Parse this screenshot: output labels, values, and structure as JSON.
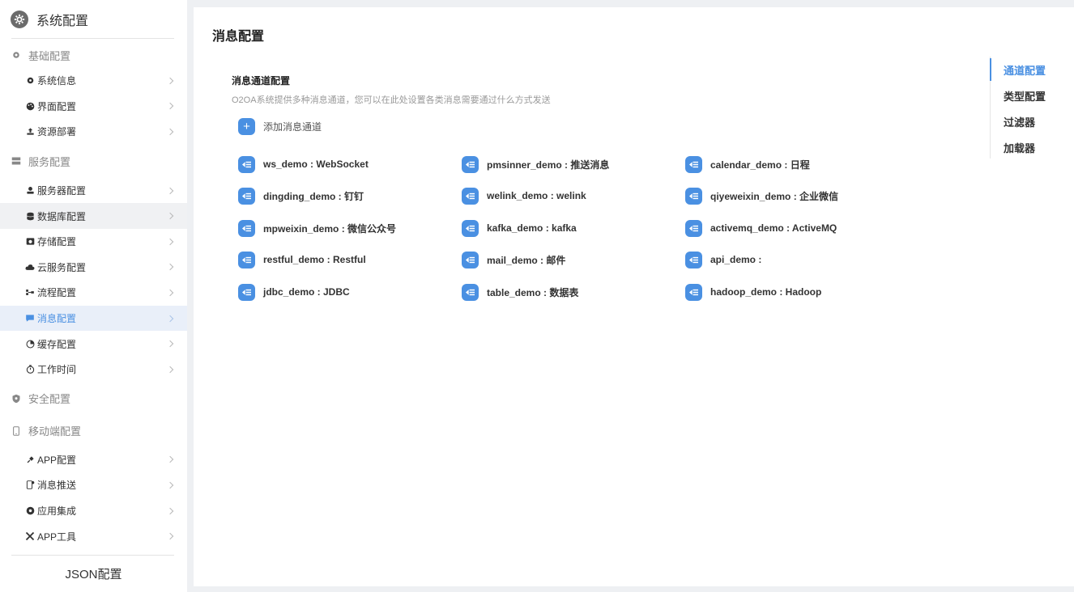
{
  "sidebar": {
    "title": "系统配置",
    "groups": [
      {
        "label": "基础配置",
        "icon": "gear-icon",
        "items": [
          {
            "label": "系统信息",
            "icon": "gear-icon"
          },
          {
            "label": "界面配置",
            "icon": "palette-icon"
          },
          {
            "label": "资源部署",
            "icon": "upload-icon"
          }
        ]
      },
      {
        "label": "服务配置",
        "icon": "server-icon",
        "items": [
          {
            "label": "服务器配置",
            "icon": "user-server-icon"
          },
          {
            "label": "数据库配置",
            "icon": "database-icon"
          },
          {
            "label": "存储配置",
            "icon": "storage-icon"
          },
          {
            "label": "云服务配置",
            "icon": "cloud-icon"
          },
          {
            "label": "流程配置",
            "icon": "flow-icon"
          },
          {
            "label": "消息配置",
            "icon": "message-icon"
          },
          {
            "label": "缓存配置",
            "icon": "pie-icon"
          },
          {
            "label": "工作时间",
            "icon": "stopwatch-icon"
          }
        ]
      },
      {
        "label": "安全配置",
        "icon": "shield-icon",
        "items": []
      },
      {
        "label": "移动端配置",
        "icon": "mobile-icon",
        "items": [
          {
            "label": "APP配置",
            "icon": "plug-icon"
          },
          {
            "label": "消息推送",
            "icon": "push-icon"
          },
          {
            "label": "应用集成",
            "icon": "compass-icon"
          },
          {
            "label": "APP工具",
            "icon": "tools-icon"
          }
        ]
      }
    ],
    "footer": "JSON配置",
    "active_item": "消息配置",
    "hover_item": "数据库配置"
  },
  "main": {
    "page_title": "消息配置",
    "section_title": "消息通道配置",
    "section_desc": "O2OA系统提供多种消息通道，您可以在此处设置各类消息需要通过什么方式发送",
    "add_label": "添加消息通道",
    "channels": [
      "ws_demo : WebSocket",
      "pmsinner_demo : 推送消息",
      "calendar_demo : 日程",
      "dingding_demo : 钉钉",
      "welink_demo : welink",
      "qiyeweixin_demo : 企业微信",
      "mpweixin_demo : 微信公众号",
      "kafka_demo : kafka",
      "activemq_demo : ActiveMQ",
      "restful_demo : Restful",
      "mail_demo : 邮件",
      "api_demo :",
      "jdbc_demo : JDBC",
      "table_demo : 数据表",
      "hadoop_demo : Hadoop"
    ],
    "right_nav": [
      "通道配置",
      "类型配置",
      "过滤器",
      "加载器"
    ],
    "right_nav_active": "通道配置"
  },
  "colors": {
    "accent": "#4a90e2",
    "sidebar_active_bg": "#e9eff9",
    "page_bg": "#eef0f3"
  }
}
